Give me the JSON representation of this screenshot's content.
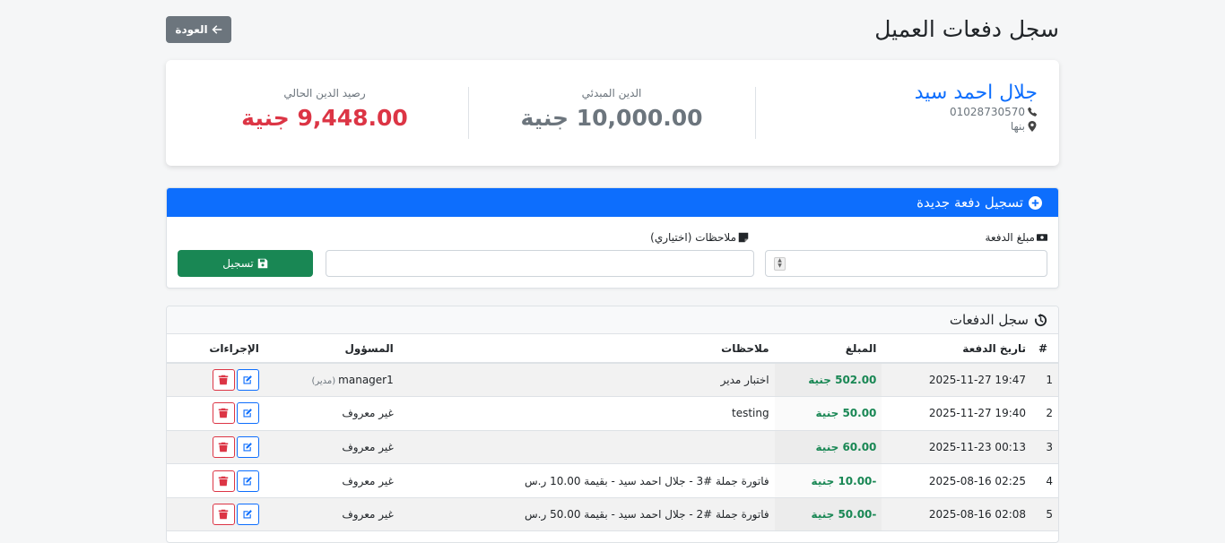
{
  "header": {
    "title": "سجل دفعات العميل",
    "back_label": "العودة"
  },
  "customer": {
    "name": "جلال احمد سيد",
    "phone": "01028730570",
    "location": "بنها"
  },
  "stats": {
    "initial_label": "الدين المبدئي",
    "initial_value": "10,000.00 جنية",
    "current_label": "رصيد الدين الحالي",
    "current_value": "9,448.00 جنية"
  },
  "new_payment": {
    "title": "تسجيل دفعة جديدة",
    "amount_label": "مبلغ الدفعة",
    "amount_value": "",
    "notes_label": "ملاحظات (اختياري)",
    "notes_value": "",
    "submit_label": "تسجيل"
  },
  "history": {
    "title": "سجل الدفعات",
    "columns": [
      "#",
      "تاريخ الدفعة",
      "المبلغ",
      "ملاحظات",
      "المسؤول",
      "الإجراءات"
    ],
    "rows": [
      {
        "num": "1",
        "date": "2025-11-27 19:47",
        "amount": "502.00 جنية",
        "notes": "اختبار مدير",
        "user": "manager1",
        "role": "(مدير)"
      },
      {
        "num": "2",
        "date": "2025-11-27 19:40",
        "amount": "50.00 جنية",
        "notes": "testing",
        "user": "غير معروف",
        "role": ""
      },
      {
        "num": "3",
        "date": "2025-11-23 00:13",
        "amount": "60.00 جنية",
        "notes": "",
        "user": "غير معروف",
        "role": ""
      },
      {
        "num": "4",
        "date": "2025-08-16 02:25",
        "amount": "-10.00 جنية",
        "notes": "فاتورة جملة #3 - جلال احمد سيد - بقيمة 10.00 ر.س",
        "user": "غير معروف",
        "role": ""
      },
      {
        "num": "5",
        "date": "2025-08-16 02:08",
        "amount": "-50.00 جنية",
        "notes": "فاتورة جملة #2 - جلال احمد سيد - بقيمة 50.00 ر.س",
        "user": "غير معروف",
        "role": ""
      }
    ]
  },
  "colors": {
    "primary": "#0d6efd",
    "success": "#198754",
    "danger": "#dc3545",
    "secondary": "#6c757d"
  }
}
